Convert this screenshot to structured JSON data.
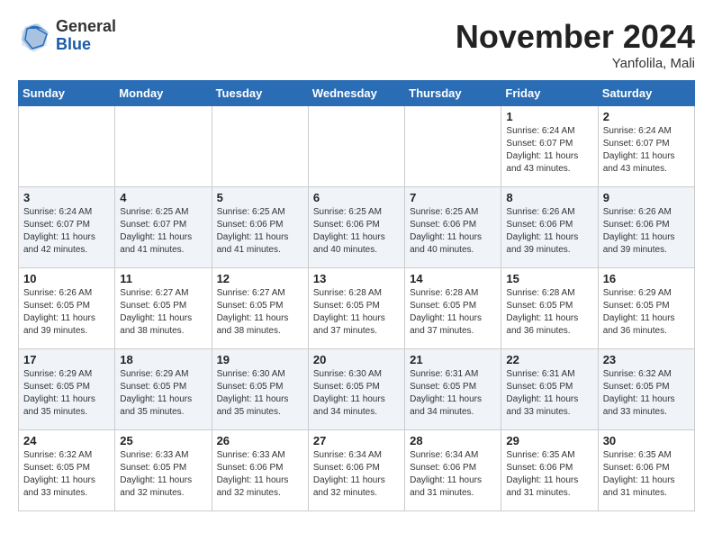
{
  "header": {
    "logo_general": "General",
    "logo_blue": "Blue",
    "month_title": "November 2024",
    "location": "Yanfolila, Mali"
  },
  "days_of_week": [
    "Sunday",
    "Monday",
    "Tuesday",
    "Wednesday",
    "Thursday",
    "Friday",
    "Saturday"
  ],
  "weeks": [
    [
      {
        "day": "",
        "info": ""
      },
      {
        "day": "",
        "info": ""
      },
      {
        "day": "",
        "info": ""
      },
      {
        "day": "",
        "info": ""
      },
      {
        "day": "",
        "info": ""
      },
      {
        "day": "1",
        "info": "Sunrise: 6:24 AM\nSunset: 6:07 PM\nDaylight: 11 hours and 43 minutes."
      },
      {
        "day": "2",
        "info": "Sunrise: 6:24 AM\nSunset: 6:07 PM\nDaylight: 11 hours and 43 minutes."
      }
    ],
    [
      {
        "day": "3",
        "info": "Sunrise: 6:24 AM\nSunset: 6:07 PM\nDaylight: 11 hours and 42 minutes."
      },
      {
        "day": "4",
        "info": "Sunrise: 6:25 AM\nSunset: 6:07 PM\nDaylight: 11 hours and 41 minutes."
      },
      {
        "day": "5",
        "info": "Sunrise: 6:25 AM\nSunset: 6:06 PM\nDaylight: 11 hours and 41 minutes."
      },
      {
        "day": "6",
        "info": "Sunrise: 6:25 AM\nSunset: 6:06 PM\nDaylight: 11 hours and 40 minutes."
      },
      {
        "day": "7",
        "info": "Sunrise: 6:25 AM\nSunset: 6:06 PM\nDaylight: 11 hours and 40 minutes."
      },
      {
        "day": "8",
        "info": "Sunrise: 6:26 AM\nSunset: 6:06 PM\nDaylight: 11 hours and 39 minutes."
      },
      {
        "day": "9",
        "info": "Sunrise: 6:26 AM\nSunset: 6:06 PM\nDaylight: 11 hours and 39 minutes."
      }
    ],
    [
      {
        "day": "10",
        "info": "Sunrise: 6:26 AM\nSunset: 6:05 PM\nDaylight: 11 hours and 39 minutes."
      },
      {
        "day": "11",
        "info": "Sunrise: 6:27 AM\nSunset: 6:05 PM\nDaylight: 11 hours and 38 minutes."
      },
      {
        "day": "12",
        "info": "Sunrise: 6:27 AM\nSunset: 6:05 PM\nDaylight: 11 hours and 38 minutes."
      },
      {
        "day": "13",
        "info": "Sunrise: 6:28 AM\nSunset: 6:05 PM\nDaylight: 11 hours and 37 minutes."
      },
      {
        "day": "14",
        "info": "Sunrise: 6:28 AM\nSunset: 6:05 PM\nDaylight: 11 hours and 37 minutes."
      },
      {
        "day": "15",
        "info": "Sunrise: 6:28 AM\nSunset: 6:05 PM\nDaylight: 11 hours and 36 minutes."
      },
      {
        "day": "16",
        "info": "Sunrise: 6:29 AM\nSunset: 6:05 PM\nDaylight: 11 hours and 36 minutes."
      }
    ],
    [
      {
        "day": "17",
        "info": "Sunrise: 6:29 AM\nSunset: 6:05 PM\nDaylight: 11 hours and 35 minutes."
      },
      {
        "day": "18",
        "info": "Sunrise: 6:29 AM\nSunset: 6:05 PM\nDaylight: 11 hours and 35 minutes."
      },
      {
        "day": "19",
        "info": "Sunrise: 6:30 AM\nSunset: 6:05 PM\nDaylight: 11 hours and 35 minutes."
      },
      {
        "day": "20",
        "info": "Sunrise: 6:30 AM\nSunset: 6:05 PM\nDaylight: 11 hours and 34 minutes."
      },
      {
        "day": "21",
        "info": "Sunrise: 6:31 AM\nSunset: 6:05 PM\nDaylight: 11 hours and 34 minutes."
      },
      {
        "day": "22",
        "info": "Sunrise: 6:31 AM\nSunset: 6:05 PM\nDaylight: 11 hours and 33 minutes."
      },
      {
        "day": "23",
        "info": "Sunrise: 6:32 AM\nSunset: 6:05 PM\nDaylight: 11 hours and 33 minutes."
      }
    ],
    [
      {
        "day": "24",
        "info": "Sunrise: 6:32 AM\nSunset: 6:05 PM\nDaylight: 11 hours and 33 minutes."
      },
      {
        "day": "25",
        "info": "Sunrise: 6:33 AM\nSunset: 6:05 PM\nDaylight: 11 hours and 32 minutes."
      },
      {
        "day": "26",
        "info": "Sunrise: 6:33 AM\nSunset: 6:06 PM\nDaylight: 11 hours and 32 minutes."
      },
      {
        "day": "27",
        "info": "Sunrise: 6:34 AM\nSunset: 6:06 PM\nDaylight: 11 hours and 32 minutes."
      },
      {
        "day": "28",
        "info": "Sunrise: 6:34 AM\nSunset: 6:06 PM\nDaylight: 11 hours and 31 minutes."
      },
      {
        "day": "29",
        "info": "Sunrise: 6:35 AM\nSunset: 6:06 PM\nDaylight: 11 hours and 31 minutes."
      },
      {
        "day": "30",
        "info": "Sunrise: 6:35 AM\nSunset: 6:06 PM\nDaylight: 11 hours and 31 minutes."
      }
    ]
  ]
}
